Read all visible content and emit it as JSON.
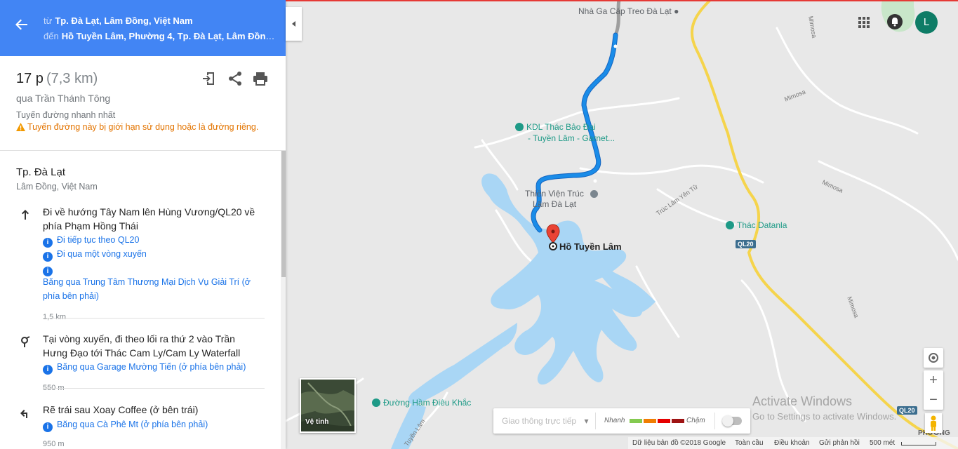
{
  "header": {
    "from_prefix": "từ",
    "from": "Tp. Đà Lạt, Lâm Đồng, Việt Nam",
    "to_prefix": "đến",
    "to": "Hồ Tuyền Lâm, Phường 4, Tp. Đà Lạt, Lâm Đồng, ..."
  },
  "summary": {
    "duration": "17 p",
    "distance": "(7,3 km)",
    "via": "qua Trần Thánh Tông",
    "fastest": "Tuyến đường nhanh nhất",
    "warning": "Tuyến đường này bị giới hạn sử dụng hoặc là đường riêng."
  },
  "origin": {
    "name": "Tp. Đà Lạt",
    "sub": "Lâm Đồng, Việt Nam"
  },
  "steps": [
    {
      "text": "Đi về hướng Tây Nam lên Hùng Vương/QL20 về phía Phạm Hồng Thái",
      "notes": [
        "Đi tiếp tục theo QL20",
        "Đi qua một vòng xuyến",
        ""
      ],
      "extra_note": "Băng qua Trung Tâm Thương Mại Dịch Vụ Giải Trí (ở phía bên phải)",
      "distance": "1,5 km"
    },
    {
      "text": "Tại vòng xuyến, đi theo lối ra thứ 2 vào Trần Hưng Đạo tới Thác Cam Ly/Cam Ly Waterfall",
      "notes": [
        "Băng qua Garage Mường Tiến (ở phía bên phải)"
      ],
      "distance": "550 m"
    },
    {
      "text": "Rẽ trái sau Xoay Coffee (ở bên trái)",
      "notes": [
        "Băng qua Cà Phê Mt (ở phía bên phải)"
      ],
      "distance": "950 m"
    }
  ],
  "map": {
    "destination": "Hồ Tuyền Lâm",
    "pois": {
      "nha_ga": "Nhà Ga Cáp Treo Đà Lạt",
      "kdl_1": "KDL Thác Bảo Đại",
      "kdl_2": "- Tuyền Lâm - Garnet...",
      "thien_vien_1": "Thiền Viện Trúc",
      "thien_vien_2": "Lâm Đà Lạt",
      "thac_datanla": "Thác Datanla",
      "duong_ham": "Đường Hầm Điêu Khắc"
    },
    "roads": {
      "mimosa": "Mimosa",
      "truc_lam": "Trúc Lâm Yên Tử",
      "tuyen_lam": "Tuyền Lâm",
      "ql20": "QL20",
      "phuong": "PHƯỜNG"
    }
  },
  "satellite_label": "Vệ tinh",
  "traffic": {
    "select": "Giao thông trực tiếp",
    "fast": "Nhanh",
    "slow": "Chậm",
    "colors": [
      "#84ca50",
      "#f07d02",
      "#e60000",
      "#9e1313"
    ]
  },
  "avatar_letter": "L",
  "watermark": {
    "line1": "Activate Windows",
    "line2": "Go to Settings to activate Windows."
  },
  "footer": {
    "data": "Dữ liệu bản đồ ©2018 Google",
    "privacy": "Toàn cầu",
    "terms": "Điều khoản",
    "feedback": "Gửi phản hồi",
    "scale": "500 mét"
  },
  "colors": {
    "accent": "#4285f4",
    "route": "#1a8ce8",
    "water": "#a9d6f5",
    "highway": "#f5d44c"
  }
}
